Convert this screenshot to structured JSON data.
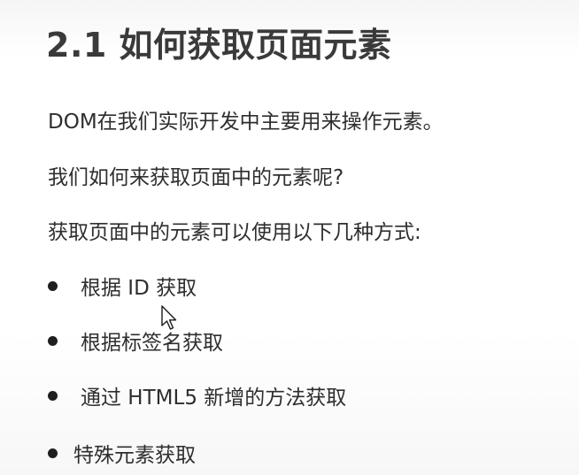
{
  "slide": {
    "title": "2.1 如何获取页面元素",
    "paragraphs": [
      "DOM在我们实际开发中主要用来操作元素。",
      "我们如何来获取页面中的元素呢?",
      "获取页面中的元素可以使用以下几种方式:"
    ],
    "bullets": [
      "根据 ID 获取",
      "根据标签名获取",
      "通过 HTML5 新增的方法获取",
      "特殊元素获取"
    ]
  },
  "icons": {
    "cursor": "mouse-pointer-icon",
    "bullet": "bullet-dot-icon"
  }
}
